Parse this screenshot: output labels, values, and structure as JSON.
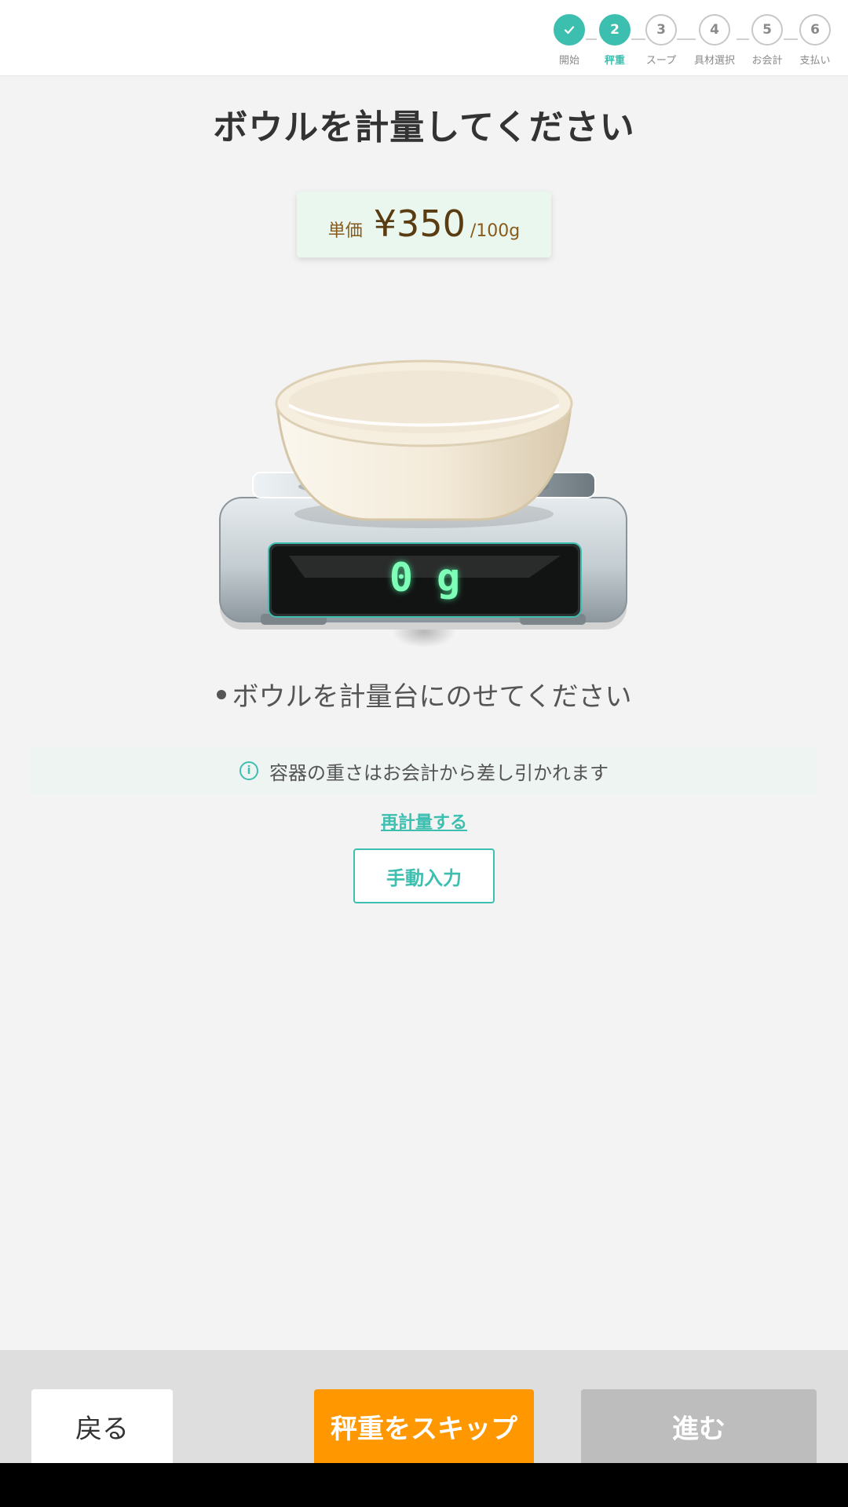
{
  "stepper": {
    "steps": [
      {
        "number": "",
        "label": "開始",
        "state": "done"
      },
      {
        "number": "2",
        "label": "秤重",
        "state": "active"
      },
      {
        "number": "3",
        "label": "スープ",
        "state": "pending"
      },
      {
        "number": "4",
        "label": "具材選択",
        "state": "pending"
      },
      {
        "number": "5",
        "label": "お会計",
        "state": "pending"
      },
      {
        "number": "6",
        "label": "支払い",
        "state": "pending"
      }
    ],
    "accent_color": "#3dbfb0"
  },
  "main": {
    "title": "ボウルを計量してください",
    "price_card": {
      "unit_label": "単価",
      "price": "¥350",
      "per": "/100g"
    },
    "scale": {
      "readout": "0 g",
      "icon": "scale-with-bowl-icon"
    },
    "instruction": "ボウルを計量台にのせてください",
    "notice": {
      "icon": "info-icon",
      "text": "容器の重さはお会計から差し引かれます"
    },
    "reweigh_link": "再計量する",
    "manual_input_button": "手動入力"
  },
  "footer": {
    "back_button": "戻る",
    "skip_button": "秤重をスキップ",
    "next_button": "進む",
    "skip_color": "#ff9800",
    "next_disabled_color": "#bdbdbd"
  }
}
